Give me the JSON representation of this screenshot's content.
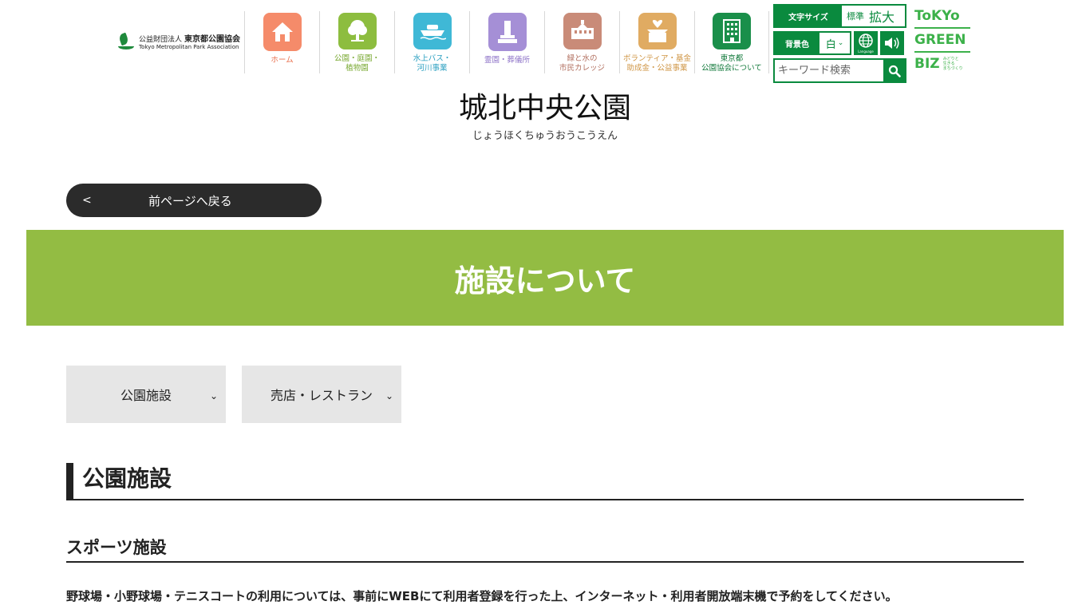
{
  "header": {
    "org_line1_prefix": "公益財団法人",
    "org_line1_name": "東京都公園協会",
    "org_line2": "Tokyo Metropolitan Park Association"
  },
  "nav": [
    {
      "label": "ホーム",
      "icon": "home-icon",
      "color": "#f58b6a",
      "text_color": "#e9704e"
    },
    {
      "label": "公園・庭園・\n植物園",
      "icon": "tree-icon",
      "color": "#8dbd3f",
      "text_color": "#78a830"
    },
    {
      "label": "水上バス・\n河川事業",
      "icon": "boat-icon",
      "color": "#3fb8d6",
      "text_color": "#2a9fc0"
    },
    {
      "label": "霊園・葬儀所",
      "icon": "grave-icon",
      "color": "#a58fd6",
      "text_color": "#8f74c8"
    },
    {
      "label": "緑と水の\n市民カレッジ",
      "icon": "school-icon",
      "color": "#c98b78",
      "text_color": "#b27060"
    },
    {
      "label": "ボランティア・基金\n助成金・公益事業",
      "icon": "donation-box-icon",
      "color": "#e0ab62",
      "text_color": "#cf9544"
    },
    {
      "label": "東京都\n公園協会について",
      "icon": "building-icon",
      "color": "#1a8f4a",
      "text_color": "#137a3c"
    }
  ],
  "tools": {
    "font_size_label": "文字サイズ",
    "font_size_standard": "標準",
    "font_size_large": "拡大",
    "bg_color_label": "背景色",
    "bg_color_value": "白",
    "language_label": "Language",
    "search_placeholder": "キーワード検索"
  },
  "tgb": {
    "line1": "ToKYo",
    "line2": "GREEN",
    "line3": "BIZ",
    "tagline": "みどりと\n生きる\nまちづくり"
  },
  "page": {
    "park_name": "城北中央公園",
    "park_kana": "じょうほくちゅうおうこうえん",
    "back_label": "前ページへ戻る",
    "banner_title": "施設について",
    "tabs": [
      "公園施設",
      "売店・レストラン"
    ],
    "section_title": "公園施設",
    "subsection_title": "スポーツ施設",
    "paragraph": "野球場・小野球場・テニスコートの利用については、事前にWEBにて利用者登録を行った上、インターネット・利用者開放端末機で予約をしてください。"
  }
}
